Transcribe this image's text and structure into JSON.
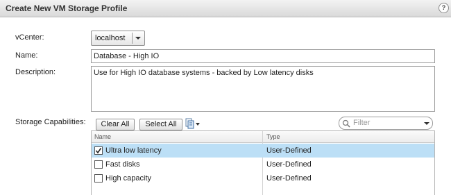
{
  "dialog": {
    "title": "Create New VM Storage Profile",
    "help": "?"
  },
  "form": {
    "vcenter_label": "vCenter:",
    "vcenter_value": "localhost",
    "name_label": "Name:",
    "name_value": "Database - High IO",
    "description_label": "Description:",
    "description_value": "Use for High IO database systems - backed by Low latency disks",
    "capabilities_label": "Storage Capabilities:"
  },
  "toolbar": {
    "clear_all": "Clear All",
    "select_all": "Select All",
    "filter_placeholder": "Filter"
  },
  "grid": {
    "columns": [
      "Name",
      "Type"
    ],
    "rows": [
      {
        "name": "Ultra low latency",
        "type": "User-Defined",
        "checked": true,
        "selected": true
      },
      {
        "name": "Fast disks",
        "type": "User-Defined",
        "checked": false,
        "selected": false
      },
      {
        "name": "High capacity",
        "type": "User-Defined",
        "checked": false,
        "selected": false
      }
    ]
  },
  "colors": {
    "selection": "#bcdff6"
  }
}
